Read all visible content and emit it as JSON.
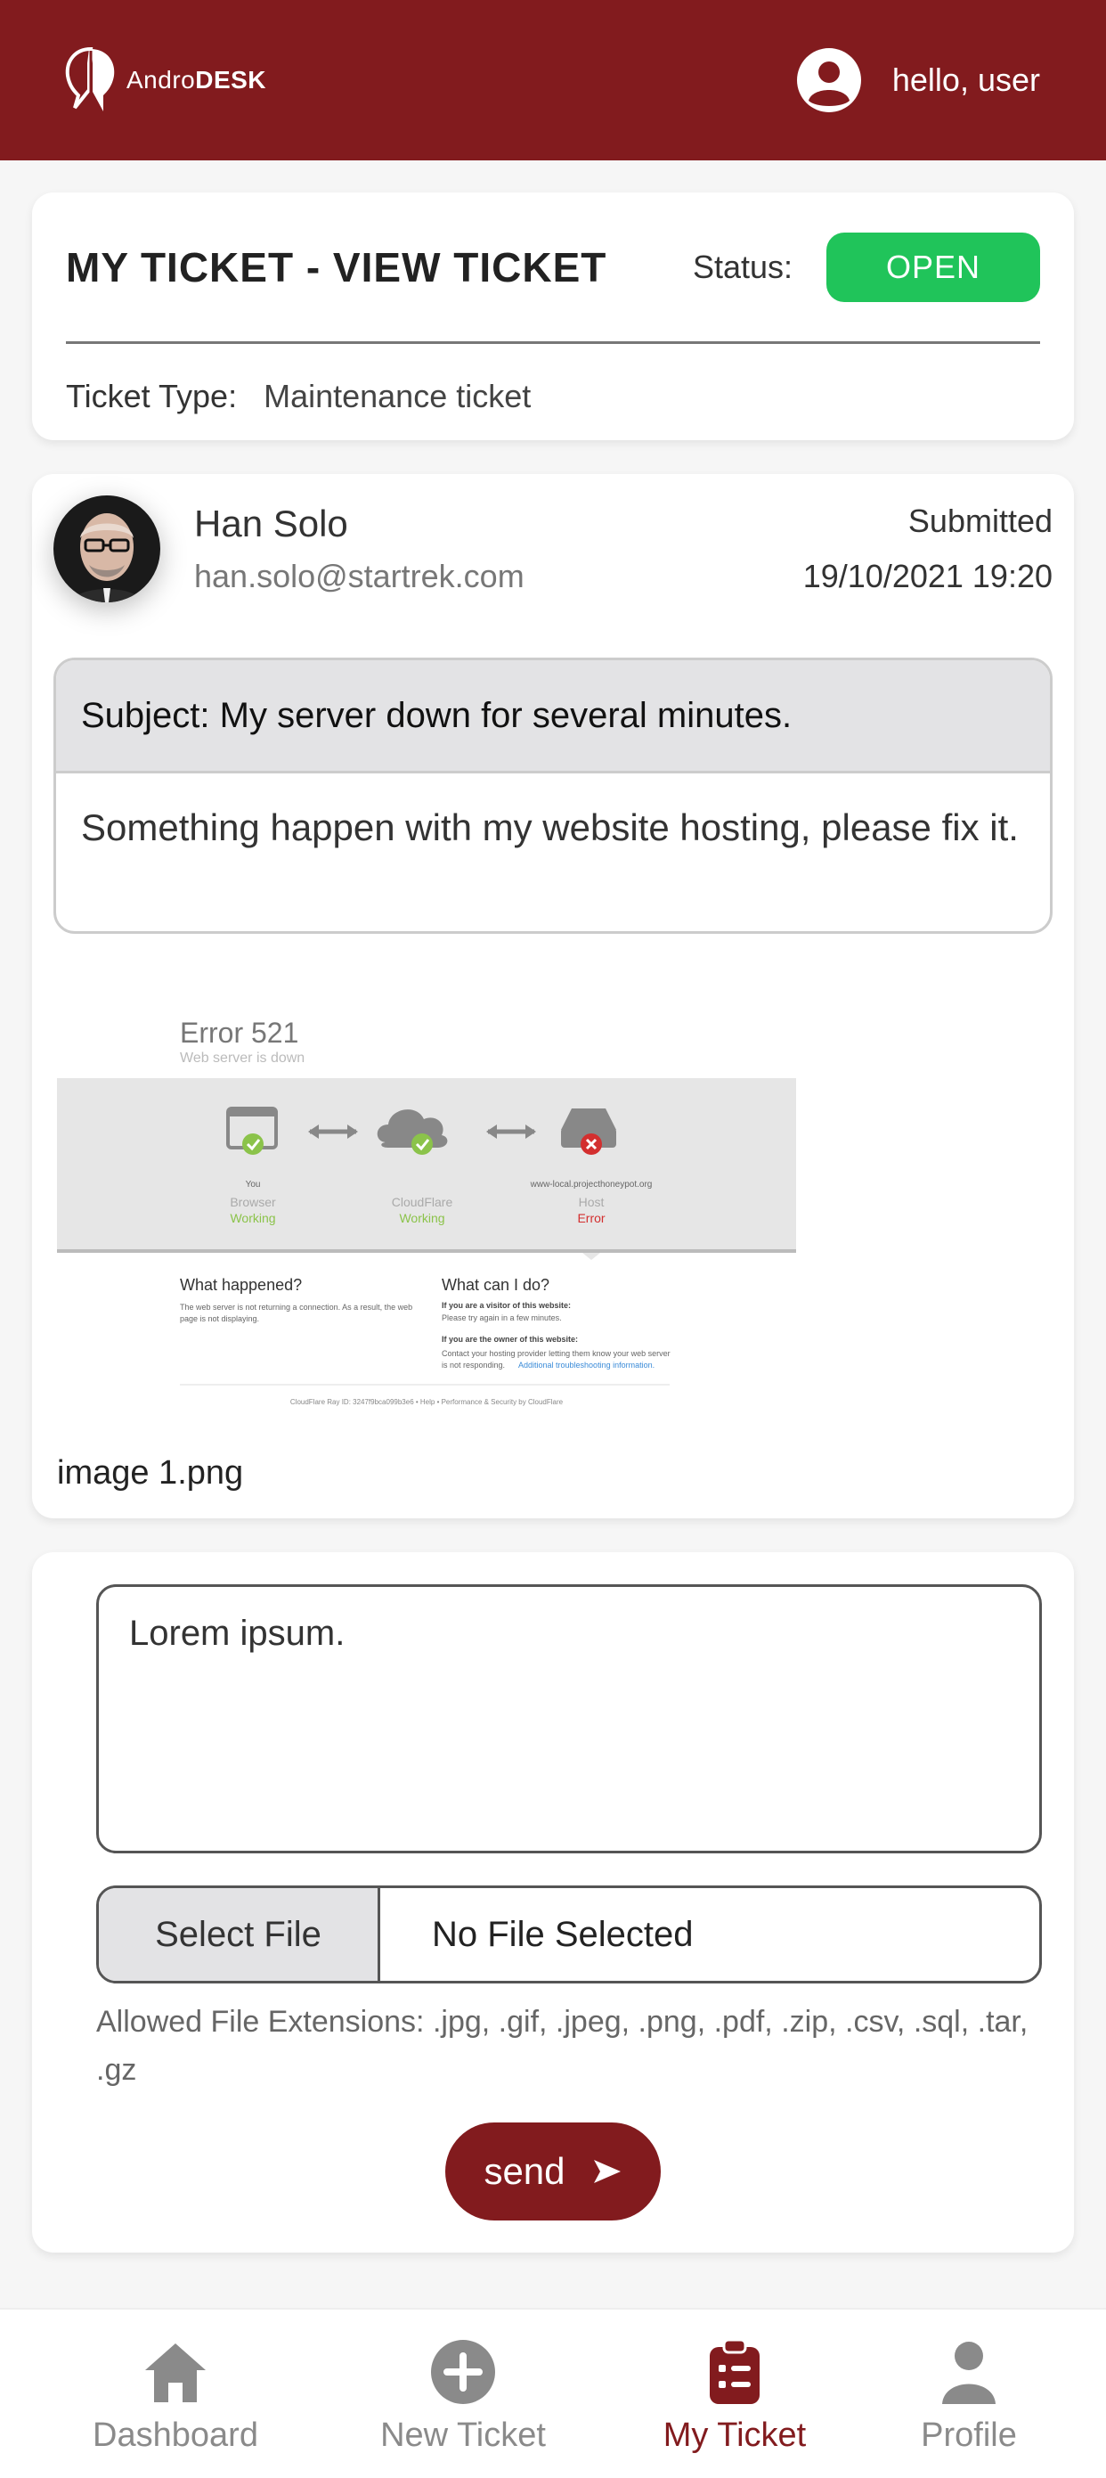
{
  "header": {
    "logo_prefix": "Andro",
    "logo_suffix": "DESK",
    "greeting": "hello, user"
  },
  "ticket_head": {
    "title": "MY TICKET - VIEW TICKET",
    "status_label": "Status:",
    "status_value": "OPEN",
    "type_label": "Ticket Type:",
    "type_value": "Maintenance ticket"
  },
  "ticket": {
    "sender_name": "Han Solo",
    "sender_email": "han.solo@startrek.com",
    "submitted_label": "Submitted",
    "submitted_date": "19/10/2021 19:20",
    "subject": "Subject: My server down for several minutes.",
    "body": "Something happen with my website hosting, please fix it.",
    "attachment": {
      "name": "image 1.png",
      "error_title": "Error 521",
      "error_subtitle": "Web server is down",
      "nodes": [
        {
          "name": "You",
          "type": "Browser",
          "state": "Working"
        },
        {
          "name": "",
          "type": "CloudFlare",
          "state": "Working"
        },
        {
          "name": "www-local.projecthoneypot.org",
          "type": "Host",
          "state": "Error"
        }
      ],
      "what_happened": "What happened?",
      "what_happened_text_1": "The web server is not returning a connection. As a result, the web",
      "what_happened_text_2": "page is not displaying.",
      "what_can_i_do": "What can I do?",
      "visitor_heading": "If you are a visitor of this website:",
      "visitor_text": "Please try again in a few minutes.",
      "owner_heading": "If you are the owner of this website:",
      "owner_text_1": "Contact your hosting provider letting them know your web server",
      "owner_text_2": "is not responding.",
      "owner_link": "Additional troubleshooting information.",
      "footer": "CloudFlare Ray ID: 3247f9bca099b3e6 • Help • Performance & Security by CloudFlare"
    }
  },
  "reply": {
    "text": "Lorem ipsum.",
    "select_file": "Select File",
    "no_file": "No File Selected",
    "allowed": "Allowed File Extensions: .jpg, .gif, .jpeg, .png, .pdf, .zip, .csv, .sql, .tar, .gz",
    "send": "send"
  },
  "nav": {
    "items": [
      {
        "label": "Dashboard",
        "icon": "home-icon",
        "active": false
      },
      {
        "label": "New Ticket",
        "icon": "plus-circle-icon",
        "active": false
      },
      {
        "label": "My Ticket",
        "icon": "clipboard-list-icon",
        "active": true
      },
      {
        "label": "Profile",
        "icon": "person-icon",
        "active": false
      }
    ]
  },
  "colors": {
    "brand": "#821b1e",
    "status_open": "#20c45a",
    "working": "#8bc34a",
    "error": "#d32f2f"
  }
}
